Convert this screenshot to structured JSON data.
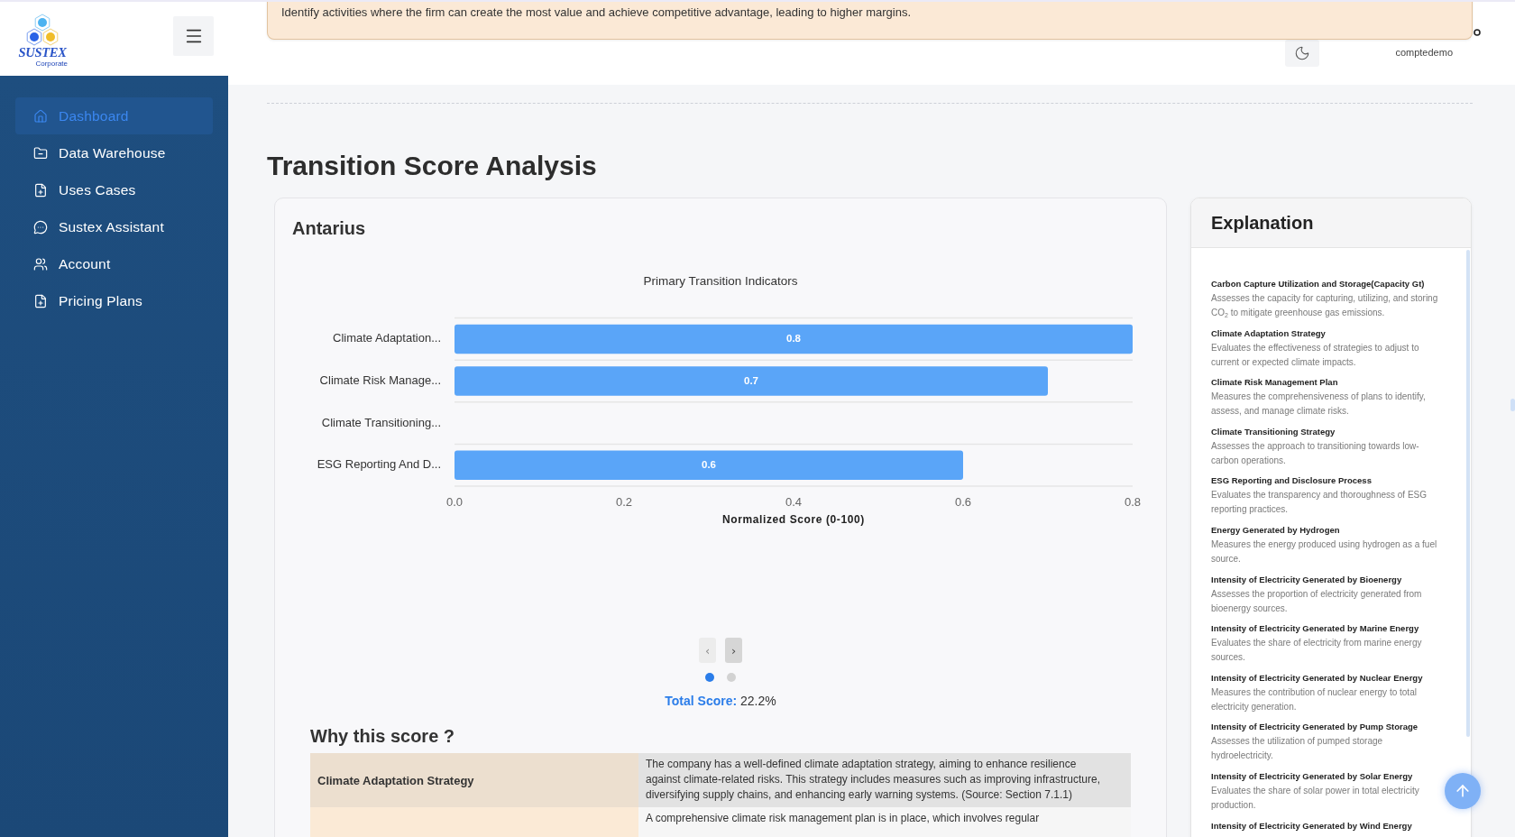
{
  "banner": {
    "text": "Identify activities where the firm can create the most value and achieve competitive advantage, leading to higher margins."
  },
  "logo": {
    "name": "SUSTEX",
    "tagline": "Corporate"
  },
  "sidebar": {
    "items": [
      {
        "label": "Dashboard",
        "selected": true
      },
      {
        "label": "Data Warehouse",
        "selected": false
      },
      {
        "label": "Uses Cases",
        "selected": false
      },
      {
        "label": "Sustex Assistant",
        "selected": false
      },
      {
        "label": "Account",
        "selected": false
      },
      {
        "label": "Pricing Plans",
        "selected": false
      }
    ]
  },
  "header": {
    "user": "comptedemo"
  },
  "page": {
    "title": "Transition Score Analysis"
  },
  "score_card": {
    "company": "Antarius",
    "chart_data": {
      "type": "bar",
      "orientation": "horizontal",
      "title": "Primary Transition Indicators",
      "xlabel": "Normalized Score (0-100)",
      "categories": [
        "Climate Adaptation...",
        "Climate Risk Manage...",
        "Climate Transitioning...",
        "ESG Reporting And D..."
      ],
      "values": [
        0.8,
        0.7,
        0,
        0.6
      ],
      "xlim": [
        0,
        0.8
      ],
      "xticks": [
        {
          "value": 0,
          "label": "0.0"
        },
        {
          "value": 0.2,
          "label": "0.2"
        },
        {
          "value": 0.4,
          "label": "0.4"
        },
        {
          "value": 0.6,
          "label": "0.6"
        },
        {
          "value": 0.8,
          "label": "0.8"
        }
      ],
      "value_labels": [
        "0.8",
        "0.7",
        null,
        "0.6"
      ]
    },
    "pager": {
      "buttons": [
        {
          "label": "‹",
          "disabled": true
        },
        {
          "label": "›",
          "disabled": false
        }
      ],
      "dots": [
        {
          "selected": true
        },
        {
          "selected": false
        }
      ]
    },
    "total_score": "**Total Score:** 22.2%",
    "why": {
      "title": "Why this score ?",
      "rows": [
        {
          "indicator": "Climate Adaptation Strategy",
          "explanation": "The company has a well-defined climate adaptation strategy, aiming to enhance resilience against climate-related risks. This strategy includes measures such as improving infrastructure, diversifying supply chains, and enhancing early warning systems. (Source: Section 7.1.1)"
        },
        {
          "explanation": "A comprehensive climate risk management plan is in place, which involves regular"
        }
      ]
    }
  },
  "explanation": {
    "title": "Explanation",
    "items": [
      {
        "title": "Carbon Capture Utilization and Storage(Capacity Gt)",
        "description": "Assesses the capacity for capturing, utilizing, and storing CO$_{2}$ to mitigate greenhouse gas emissions."
      },
      {
        "title": "Climate Adaptation Strategy",
        "description": "Evaluates the effectiveness of strategies to adjust to current or expected climate impacts."
      },
      {
        "title": "Climate Risk Management Plan",
        "description": "Measures the comprehensiveness of plans to identify, assess, and manage climate risks."
      },
      {
        "title": "Climate Transitioning Strategy",
        "description": "Assesses the approach to transitioning towards low-carbon operations."
      },
      {
        "title": "ESG Reporting and Disclosure Process",
        "description": "Evaluates the transparency and thoroughness of ESG reporting practices."
      },
      {
        "title": "Energy Generated by Hydrogen",
        "description": "Measures the energy produced using hydrogen as a fuel source."
      },
      {
        "title": "Intensity of Electricity Generated by Bioenergy",
        "description": "Assesses the proportion of electricity generated from bioenergy sources."
      },
      {
        "title": "Intensity of Electricity Generated by Marine Energy",
        "description": "Evaluates the share of electricity from marine energy sources."
      },
      {
        "title": "Intensity of Electricity Generated by Nuclear Energy",
        "description": "Measures the contribution of nuclear energy to total electricity generation."
      },
      {
        "title": "Intensity of Electricity Generated by Pump Storage",
        "description": "Assesses the utilization of pumped storage hydroelectricity."
      },
      {
        "title": "Intensity of Electricity Generated by Solar Energy",
        "description": "Evaluates the share of solar power in total electricity production."
      },
      {
        "title": "Intensity of Electricity Generated by Wind Energy"
      }
    ]
  }
}
